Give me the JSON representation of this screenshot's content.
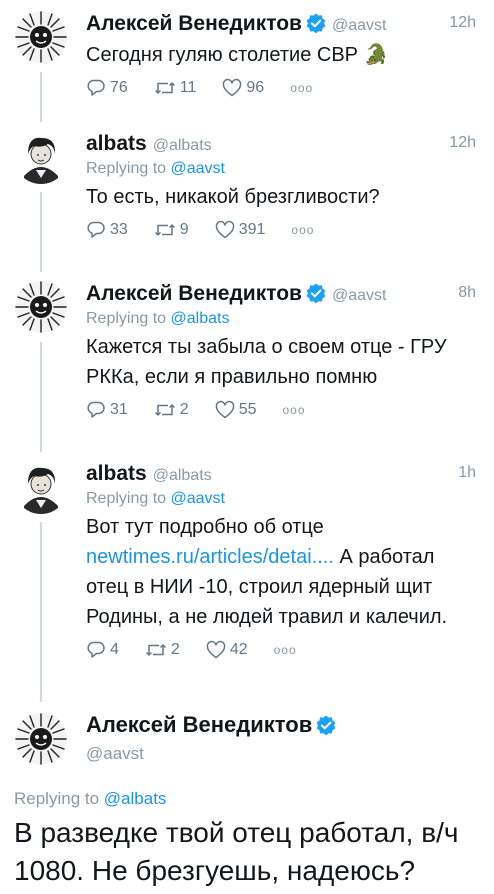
{
  "tweets": [
    {
      "name": "Алексей Венедиктов",
      "handle": "@aavst",
      "time": "12h",
      "text": "Сегодня гуляю столетие СВР 🐊",
      "replies": "76",
      "retweets": "11",
      "likes": "96"
    },
    {
      "name": "albats",
      "handle": "@albats",
      "time": "12h",
      "replying_label": "Replying to",
      "replying_to": "@aavst",
      "text": "То есть, никакой брезгливости?",
      "replies": "33",
      "retweets": "9",
      "likes": "391"
    },
    {
      "name": "Алексей Венедиктов",
      "handle": "@aavst",
      "time": "8h",
      "replying_label": "Replying to",
      "replying_to": "@albats",
      "text": "Кажется ты забыла о своем отце - ГРУ РККа, если я правильно помню",
      "replies": "31",
      "retweets": "2",
      "likes": "55"
    },
    {
      "name": "albats",
      "handle": "@albats",
      "time": "1h",
      "replying_label": "Replying to",
      "replying_to": "@aavst",
      "text_before": "Вот тут подробно об отце",
      "link": "newtimes.ru/articles/detai....",
      "text_after": "А работал отец в НИИ -10, строил ядерный щит Родины, а не людей травил и калечил.",
      "replies": "4",
      "retweets": "2",
      "likes": "42"
    }
  ],
  "main_tweet": {
    "name": "Алексей Венедиктов",
    "handle": "@aavst",
    "replying_label": "Replying to",
    "replying_to": "@albats",
    "text": "В разведке твой отец работал, в/ч 1080. Не брезгуешь, надеюсь?"
  },
  "more_label": "ooo",
  "colors": {
    "link": "#1b95e0",
    "verified": "#1da1f2",
    "muted": "#8899a6",
    "thread_line": "#cfd9de"
  }
}
